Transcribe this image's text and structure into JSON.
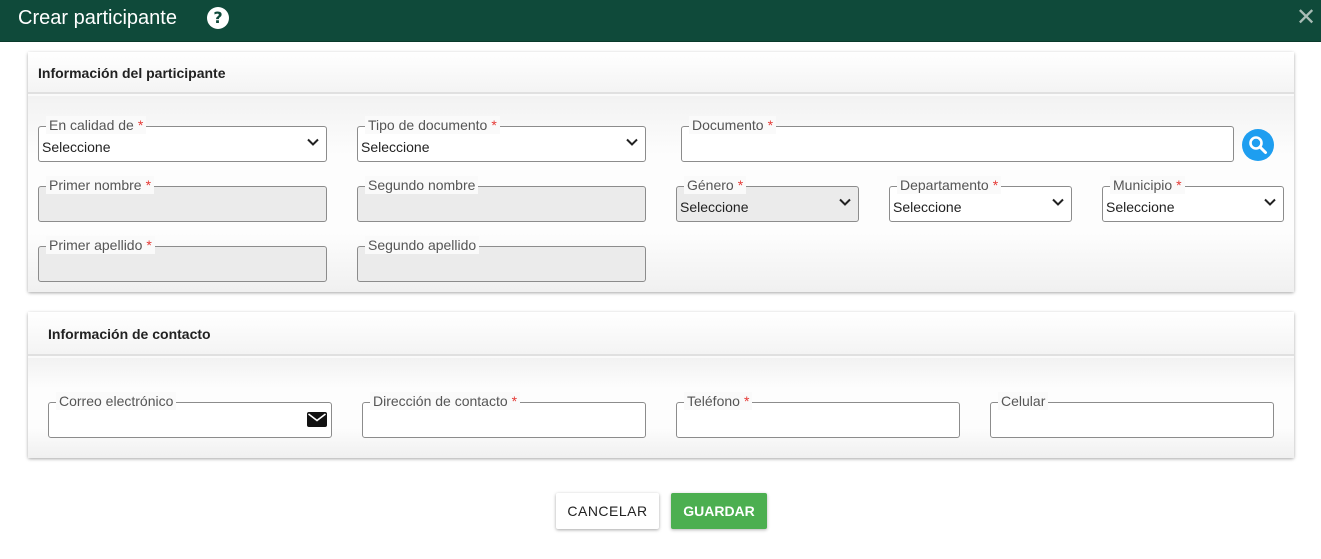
{
  "dialog": {
    "title": "Crear participante",
    "help_icon": "question-circle-icon",
    "close_icon": "close-icon",
    "close_glyph": "✕",
    "help_glyph": "?"
  },
  "participant_section": {
    "title": "Información del participante",
    "fields": {
      "en_calidad_de": {
        "label": "En calidad de",
        "required": "*",
        "value": "Seleccione"
      },
      "tipo_documento": {
        "label": "Tipo de documento",
        "required": "*",
        "value": "Seleccione"
      },
      "documento": {
        "label": "Documento",
        "required": "*",
        "value": ""
      },
      "primer_nombre": {
        "label": "Primer nombre",
        "required": "*",
        "value": ""
      },
      "segundo_nombre": {
        "label": "Segundo nombre",
        "value": ""
      },
      "genero": {
        "label": "Género",
        "required": "*",
        "value": "Seleccione"
      },
      "departamento": {
        "label": "Departamento",
        "required": "*",
        "value": "Seleccione"
      },
      "municipio": {
        "label": "Municipio",
        "required": "*",
        "value": "Seleccione"
      },
      "primer_apellido": {
        "label": "Primer apellido",
        "required": "*",
        "value": ""
      },
      "segundo_apellido": {
        "label": "Segundo apellido",
        "value": ""
      }
    },
    "search_icon": "search-icon"
  },
  "contact_section": {
    "title": "Información de contacto",
    "fields": {
      "correo": {
        "label": "Correo electrónico",
        "value": "",
        "icon": "envelope-icon"
      },
      "direccion": {
        "label": "Dirección de contacto",
        "required": "*",
        "value": ""
      },
      "telefono": {
        "label": "Teléfono",
        "required": "*",
        "value": ""
      },
      "celular": {
        "label": "Celular",
        "value": ""
      }
    }
  },
  "actions": {
    "cancel_label": "CANCELAR",
    "save_label": "GUARDAR"
  },
  "colors": {
    "header_bg": "#0f4a3a",
    "required": "#e53935",
    "search_btn": "#1e9ef0",
    "save_btn": "#4caf50"
  }
}
